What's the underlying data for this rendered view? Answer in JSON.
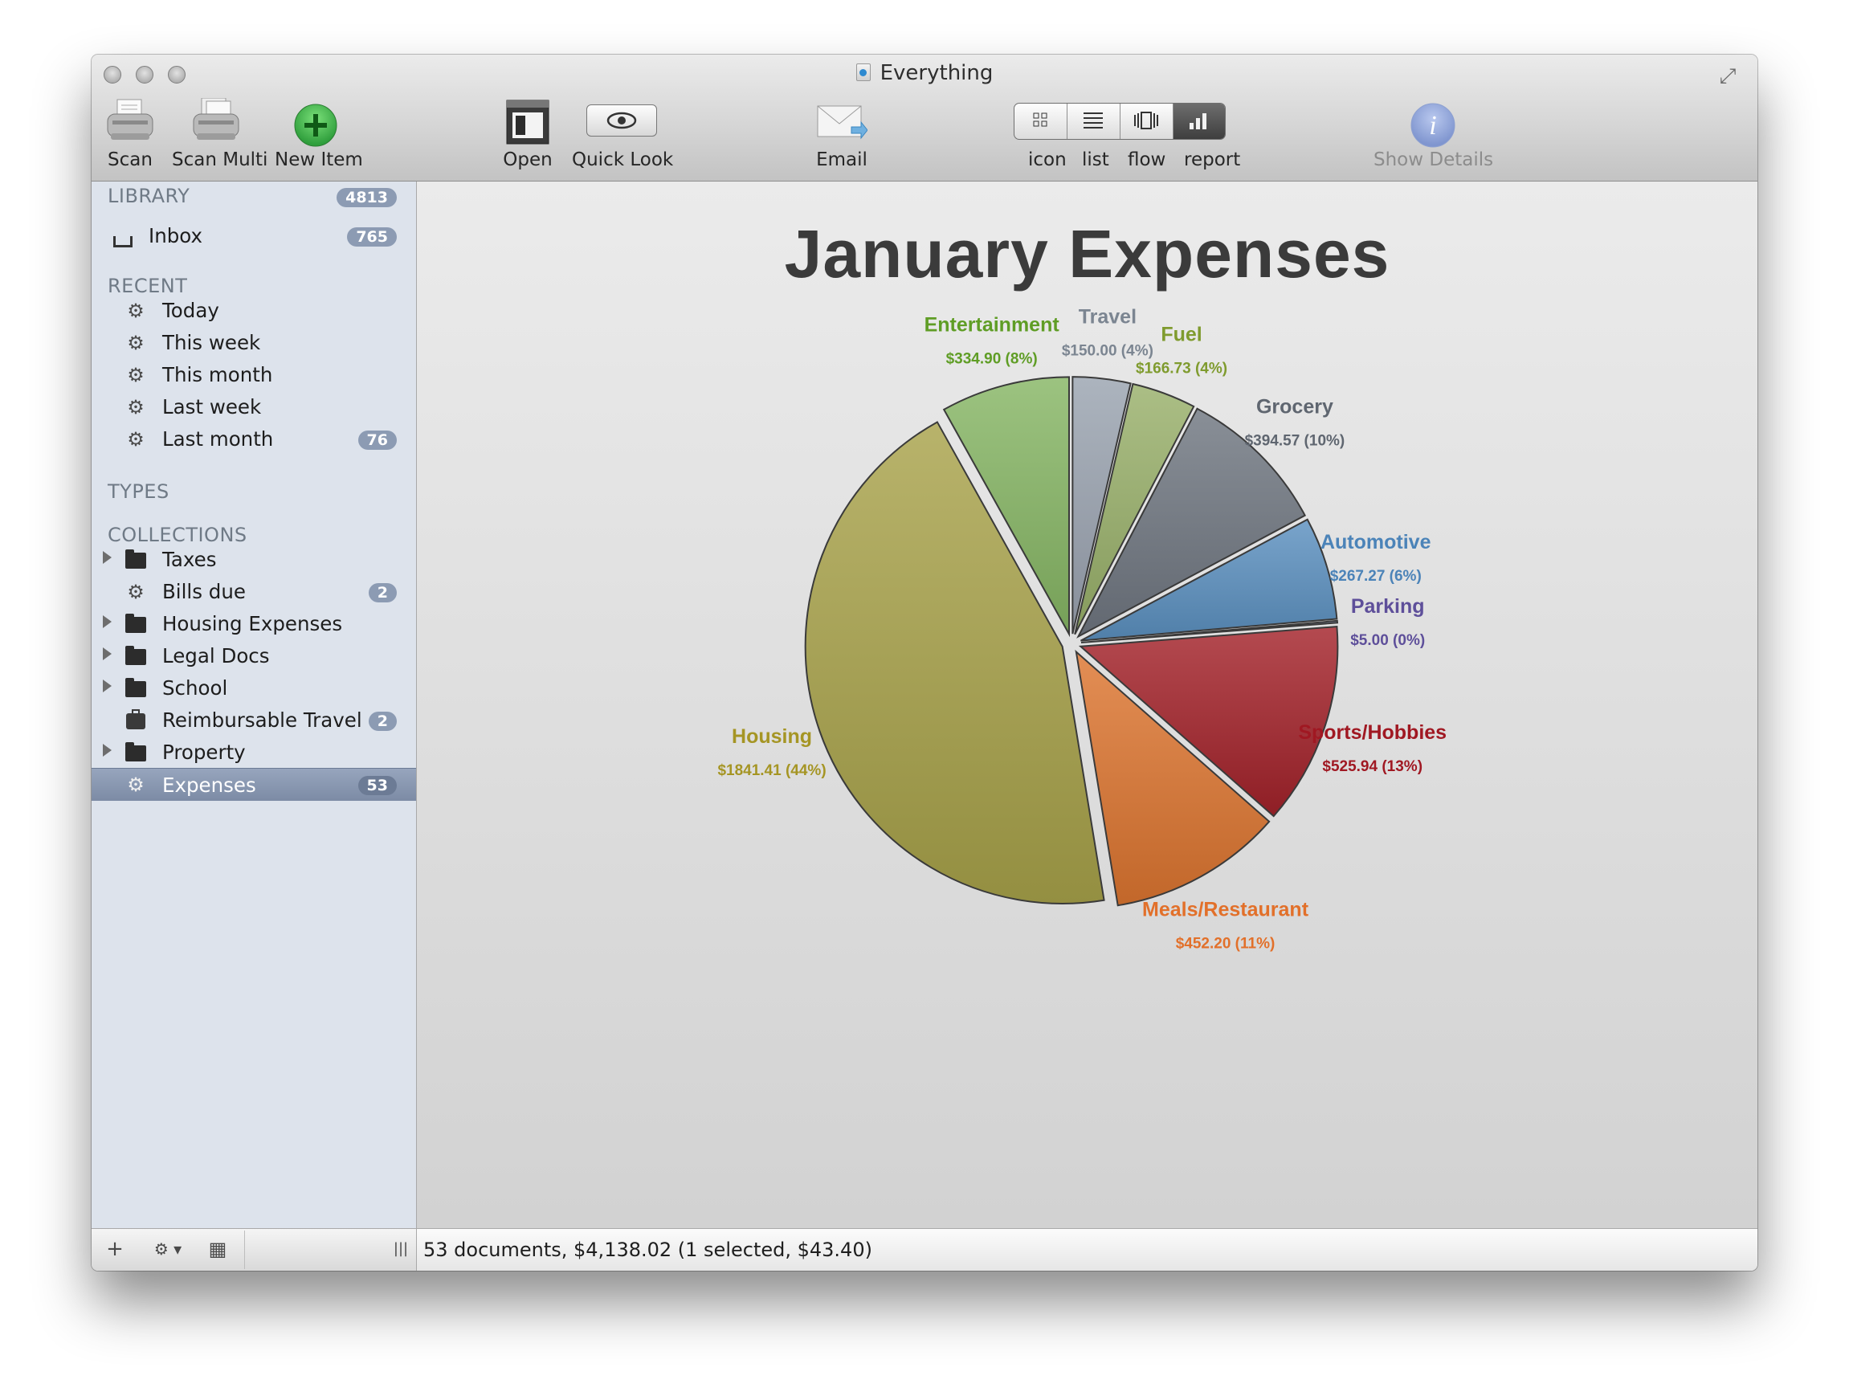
{
  "window": {
    "title": "Everything"
  },
  "toolbar": {
    "scan": "Scan",
    "scan_multi": "Scan Multi",
    "new_item": "New Item",
    "open": "Open",
    "quick_look": "Quick Look",
    "email": "Email",
    "view_icon": "icon",
    "view_list": "list",
    "view_flow": "flow",
    "view_report": "report",
    "show_details": "Show Details"
  },
  "sidebar": {
    "library_heading": "LIBRARY",
    "library_count": "4813",
    "inbox": {
      "label": "Inbox",
      "count": "765"
    },
    "recent_heading": "RECENT",
    "recent": [
      {
        "label": "Today"
      },
      {
        "label": "This week"
      },
      {
        "label": "This month"
      },
      {
        "label": "Last week"
      },
      {
        "label": "Last month",
        "count": "76"
      }
    ],
    "types_heading": "TYPES",
    "collections_heading": "COLLECTIONS",
    "collections": [
      {
        "label": "Taxes"
      },
      {
        "label": "Bills due",
        "count": "2"
      },
      {
        "label": "Housing Expenses"
      },
      {
        "label": "Legal Docs"
      },
      {
        "label": "School"
      },
      {
        "label": "Reimbursable Travel",
        "count": "2"
      },
      {
        "label": "Property"
      },
      {
        "label": "Expenses",
        "count": "53"
      }
    ]
  },
  "footer": {
    "sidebar_buttons": [
      "+",
      "⚙ ▾",
      "▦",
      "|||"
    ]
  },
  "status": {
    "text": "53 documents, $4,138.02 (1 selected, $43.40)"
  },
  "chart_data": {
    "type": "pie",
    "title": "January Expenses",
    "slices": [
      {
        "name": "Travel",
        "value": 150.0,
        "label": "$150.00 (4%)",
        "color": "#9aa3b0",
        "label_color": "#7b8591"
      },
      {
        "name": "Fuel",
        "value": 166.73,
        "label": "$166.73 (4%)",
        "color": "#98b06a",
        "label_color": "#7f9b2e"
      },
      {
        "name": "Grocery",
        "value": 394.57,
        "label": "$394.57 (10%)",
        "color": "#6f7680",
        "label_color": "#5f6670"
      },
      {
        "name": "Automotive",
        "value": 267.27,
        "label": "$267.27 (6%)",
        "color": "#5b90c0",
        "label_color": "#4b83b8"
      },
      {
        "name": "Parking",
        "value": 5.0,
        "label": "$5.00 (0%)",
        "color": "#7b8ab8",
        "label_color": "#5e4f9a"
      },
      {
        "name": "Sports/Hobbies",
        "value": 525.94,
        "label": "$525.94 (13%)",
        "color": "#a3222a",
        "label_color": "#a01822"
      },
      {
        "name": "Meals/Restaurant",
        "value": 452.2,
        "label": "$452.20 (11%)",
        "color": "#dd7530",
        "label_color": "#e2702a"
      },
      {
        "name": "Housing",
        "value": 1841.41,
        "label": "$1841.41 (44%)",
        "color": "#a8a24a",
        "label_color": "#a59524"
      },
      {
        "name": "Entertainment",
        "value": 334.9,
        "label": "$334.90 (8%)",
        "color": "#86b664",
        "label_color": "#5f9d25"
      }
    ]
  }
}
